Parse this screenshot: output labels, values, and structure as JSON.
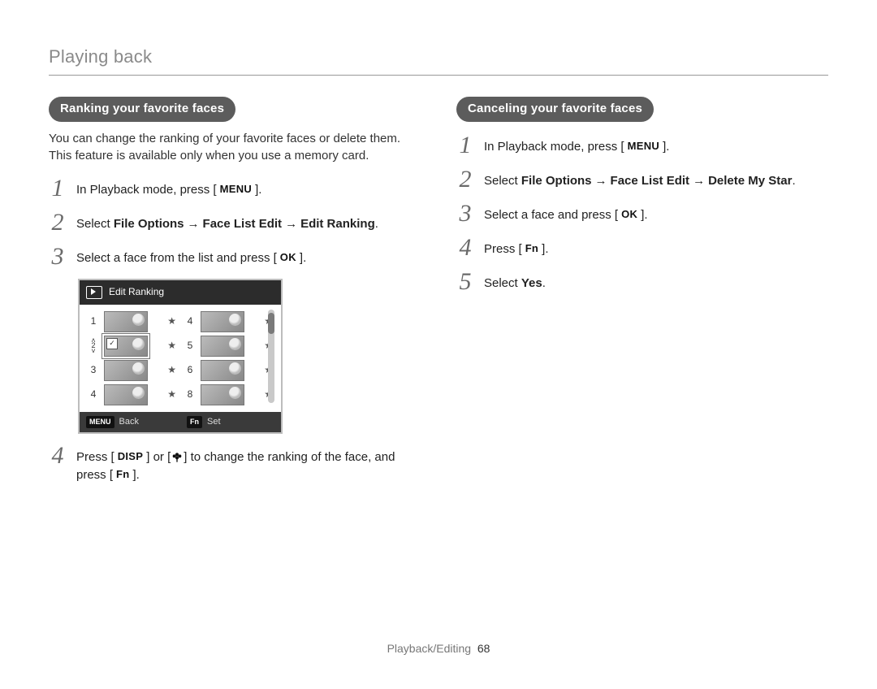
{
  "header": {
    "section": "Playing back"
  },
  "left": {
    "pill": "Ranking your favorite faces",
    "intro": "You can change the ranking of your favorite faces or delete them. This feature is available only when you use a memory card.",
    "steps": {
      "s1_pre": "In Playback mode, press [",
      "s1_btn": "MENU",
      "s1_post": "].",
      "s2_pre": "Select ",
      "s2_b1": "File Options",
      "s2_arrow": "→",
      "s2_b2": "Face List Edit",
      "s2_b3": "Edit Ranking",
      "s2_post": ".",
      "s3_pre": "Select a face from the list and press [",
      "s3_btn": "OK",
      "s3_post": "].",
      "s4_pre": "Press [",
      "s4_btn1": "DISP",
      "s4_mid": "] or [",
      "s4_iconAlt": "macro/flower",
      "s4_post1": "] to change the ranking of the face, and press [",
      "s4_btn2": "Fn",
      "s4_post2": "]."
    },
    "screenshot": {
      "title": "Edit Ranking",
      "leftRanks": [
        "1",
        "2",
        "3",
        "4"
      ],
      "rightRanks": [
        "4",
        "5",
        "6",
        "8"
      ],
      "footBackLabel": "MENU",
      "footBackText": "Back",
      "footSetLabel": "Fn",
      "footSetText": "Set"
    }
  },
  "right": {
    "pill": "Canceling your favorite faces",
    "steps": {
      "s1_pre": "In Playback mode, press [",
      "s1_btn": "MENU",
      "s1_post": "].",
      "s2_pre": "Select ",
      "s2_b1": "File Options",
      "s2_arrow": "→",
      "s2_b2": "Face List Edit",
      "s2_b3": "Delete My Star",
      "s2_post": ".",
      "s3_pre": "Select a face and press [",
      "s3_btn": "OK",
      "s3_post": "].",
      "s4_pre": "Press [",
      "s4_btn": "Fn",
      "s4_post": "].",
      "s5_pre": "Select ",
      "s5_b": "Yes",
      "s5_post": "."
    }
  },
  "footer": {
    "crumb": "Playback/Editing",
    "page": "68"
  },
  "nums": {
    "n1": "1",
    "n2": "2",
    "n3": "3",
    "n4": "4",
    "n5": "5"
  },
  "icons": {
    "star": "★",
    "check": "✓",
    "caretUp": "˄",
    "caretDown": "˅"
  }
}
